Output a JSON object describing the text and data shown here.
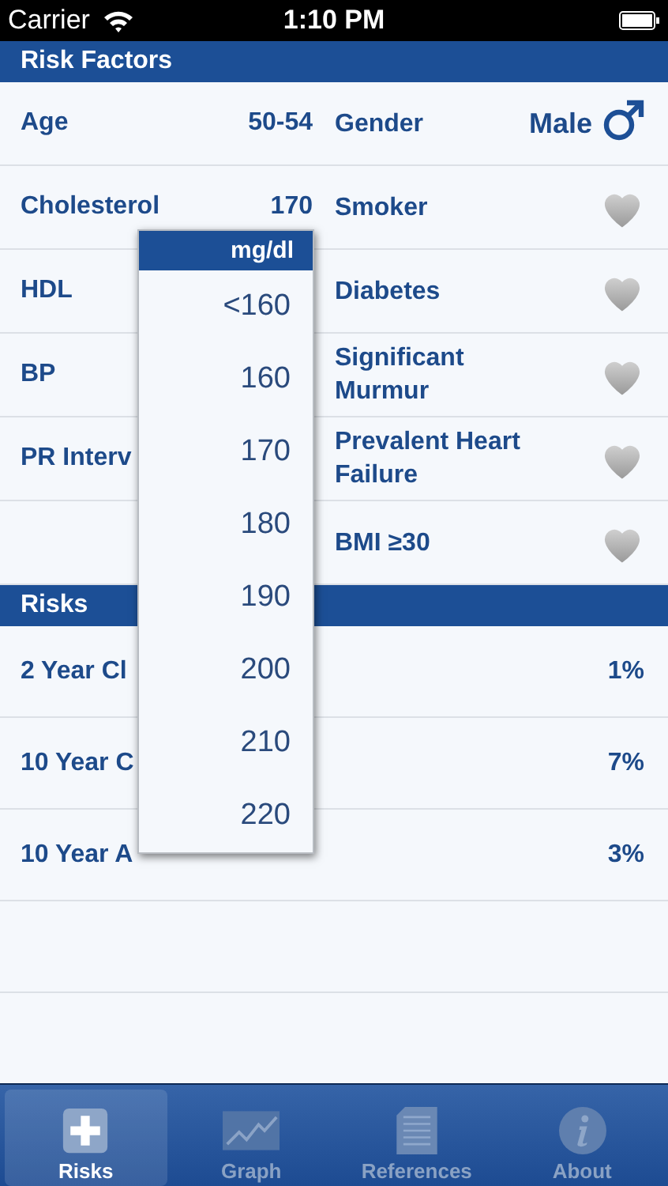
{
  "status_bar": {
    "carrier": "Carrier",
    "time": "1:10 PM"
  },
  "risk_factors": {
    "title": "Risk Factors",
    "rows": [
      {
        "left": {
          "label": "Age",
          "value": "50-54"
        },
        "right": {
          "label": "Gender",
          "value": "Male",
          "kind": "gender"
        }
      },
      {
        "left": {
          "label": "Cholesterol",
          "value": "170"
        },
        "right": {
          "label": "Smoker",
          "kind": "toggle",
          "on": false
        }
      },
      {
        "left": {
          "label": "HDL"
        },
        "right": {
          "label": "Diabetes",
          "kind": "toggle",
          "on": false
        }
      },
      {
        "left": {
          "label": "BP"
        },
        "right": {
          "label": "Significant Murmur",
          "kind": "toggle",
          "on": false
        }
      },
      {
        "left": {
          "label": "PR Interv"
        },
        "right": {
          "label": "Prevalent Heart Failure",
          "kind": "toggle",
          "on": false
        }
      },
      {
        "right": {
          "label": "BMI ≥30",
          "kind": "toggle",
          "on": false
        }
      }
    ]
  },
  "risks": {
    "title": "Risks",
    "rows": [
      {
        "label": "2 Year Cl",
        "value": "1%"
      },
      {
        "label": "10 Year C",
        "value": "7%"
      },
      {
        "label": "10 Year A",
        "value": "3%"
      }
    ]
  },
  "picker": {
    "title": "mg/dl",
    "options": [
      "<160",
      "160",
      "170",
      "180",
      "190",
      "200",
      "210",
      "220"
    ]
  },
  "tabs": [
    {
      "label": "Risks",
      "kind": "plus",
      "selected": true
    },
    {
      "label": "Graph",
      "kind": "graph",
      "selected": false
    },
    {
      "label": "References",
      "kind": "document",
      "selected": false
    },
    {
      "label": "About",
      "kind": "info",
      "selected": false
    }
  ]
}
